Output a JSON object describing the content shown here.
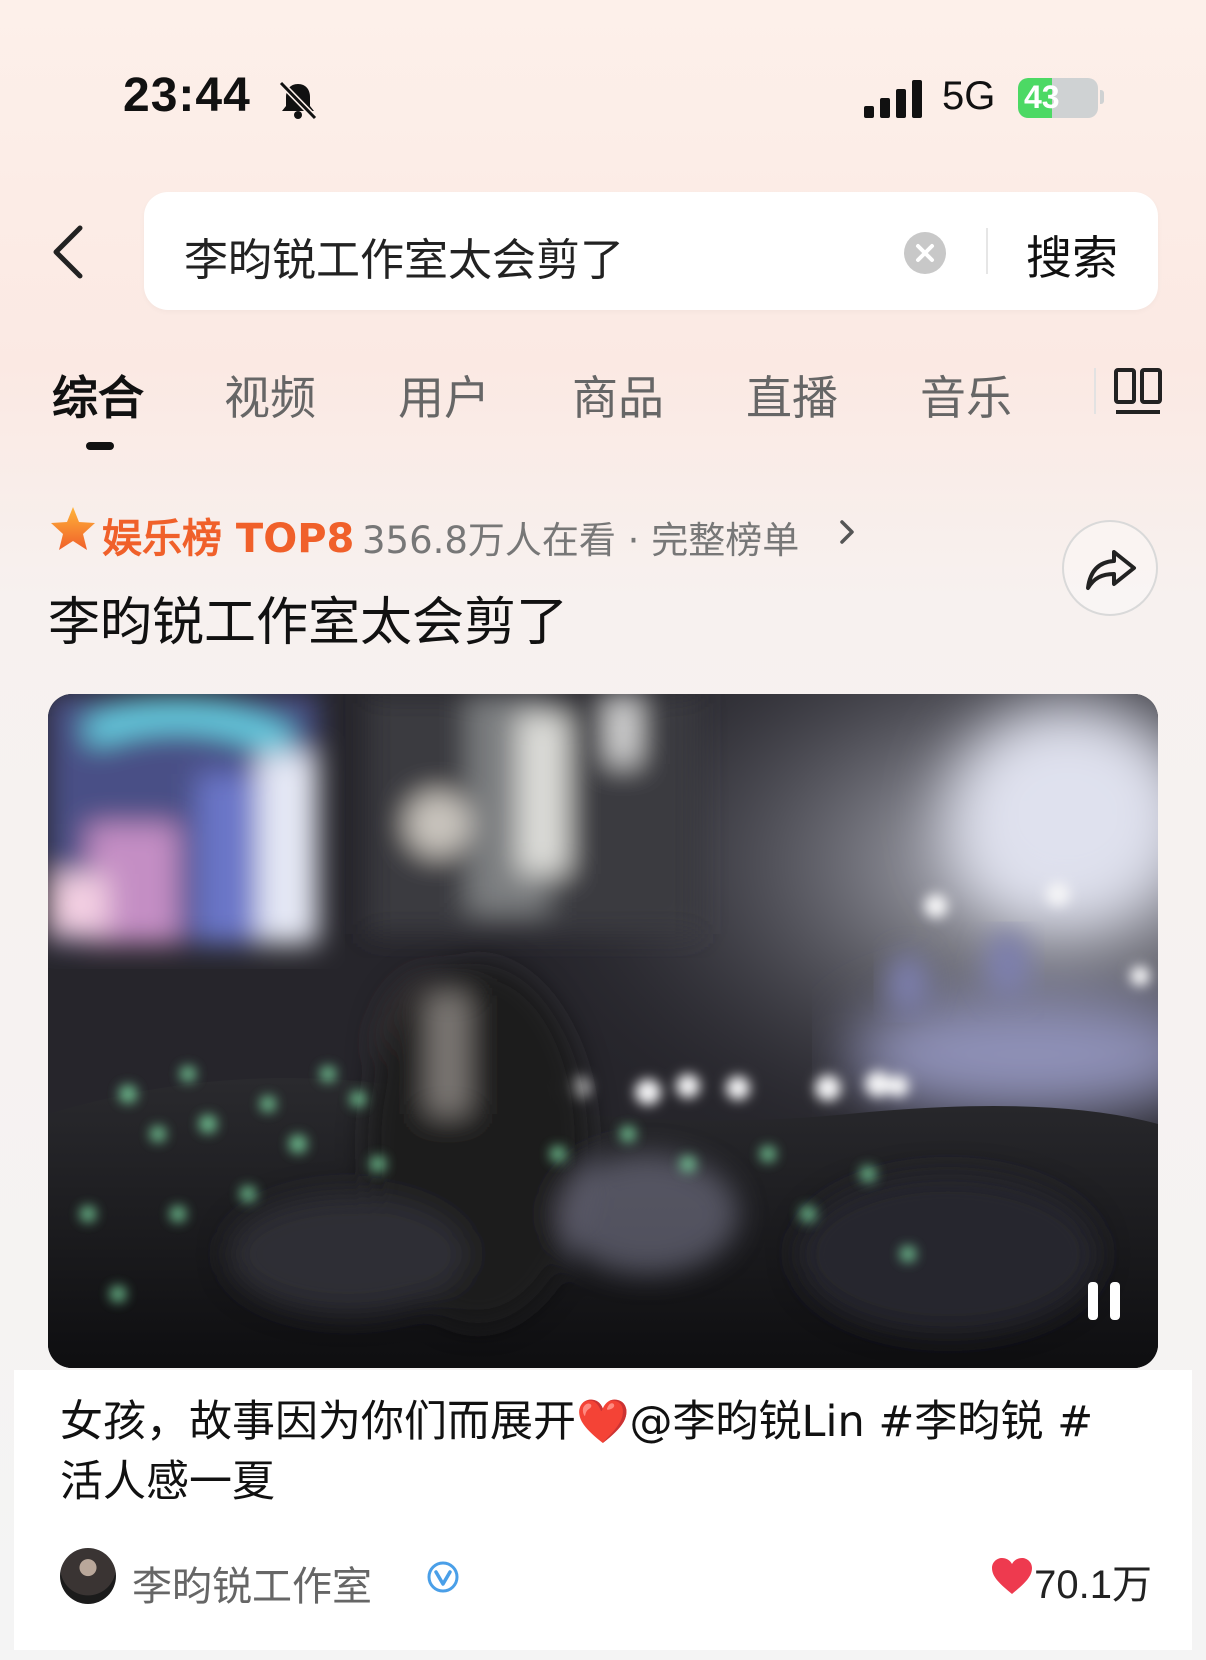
{
  "status_bar": {
    "time": "23:44",
    "network": "5G",
    "battery": "43",
    "battery_percent": 43,
    "icons": [
      "bell-muted-icon",
      "signal-icon",
      "battery-charging-icon"
    ]
  },
  "search": {
    "query": "李昀锐工作室太会剪了",
    "submit_label": "搜索",
    "icons": [
      "back-icon",
      "clear-icon"
    ]
  },
  "tabs": [
    {
      "label": "综合",
      "active": true
    },
    {
      "label": "视频",
      "active": false
    },
    {
      "label": "用户",
      "active": false
    },
    {
      "label": "商品",
      "active": false
    },
    {
      "label": "直播",
      "active": false
    },
    {
      "label": "音乐",
      "active": false
    }
  ],
  "hot_list": {
    "label": "娱乐榜 TOP8",
    "meta": "356.8万人在看 · 完整榜单",
    "topic_title": "李昀锐工作室太会剪了"
  },
  "post": {
    "caption_line1": "女孩，故事因为你们而展开",
    "caption_heart": "❤️",
    "caption_line2": "@李昀锐Lin  #李昀锐 #活人感一夏",
    "author": "李昀锐工作室",
    "likes": "70.1万"
  },
  "colors": {
    "accent_orange": "#f0602a",
    "like_red": "#ee3a4f",
    "verified_blue": "#4a9fe8"
  }
}
